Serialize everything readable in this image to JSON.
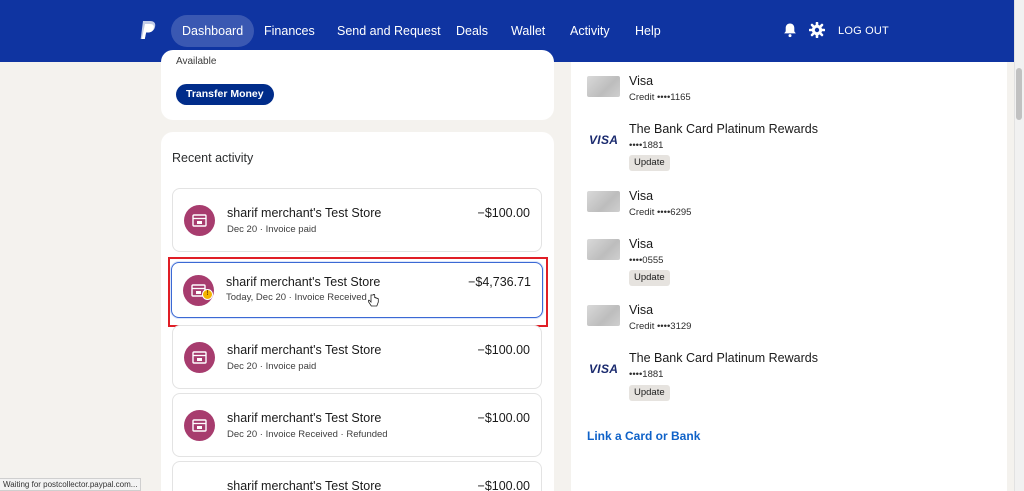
{
  "header": {
    "nav": [
      "Dashboard",
      "Finances",
      "Send and Request",
      "Deals",
      "Wallet",
      "Activity",
      "Help"
    ],
    "logout": "LOG OUT",
    "icons": [
      "paypal-logo",
      "bell-icon",
      "gear-icon"
    ],
    "colors": {
      "bar": "#0f34a1"
    }
  },
  "balance": {
    "available_label": "Available",
    "transfer_label": "Transfer Money"
  },
  "activity": {
    "title": "Recent activity",
    "rows": [
      {
        "merchant": "sharif merchant's Test Store",
        "date": "Dec 20",
        "status": "Invoice paid",
        "amount": "−$100.00"
      },
      {
        "merchant": "sharif merchant's Test Store",
        "date": "Today, Dec 20",
        "status": "Invoice Received",
        "amount": "−$4,736.71"
      },
      {
        "merchant": "sharif merchant's Test Store",
        "date": "Dec 20",
        "status": "Invoice paid",
        "amount": "−$100.00"
      },
      {
        "merchant": "sharif merchant's Test Store",
        "date": "Dec 20",
        "status": "Invoice Received",
        "status2": "Refunded",
        "amount": "−$100.00"
      },
      {
        "merchant": "sharif merchant's Test Store",
        "amount": "−$100.00"
      }
    ]
  },
  "wallet": {
    "cards": [
      {
        "name": "Visa",
        "detail": "Credit ••••1165"
      },
      {
        "name": "The Bank Card Platinum Rewards",
        "detail": "••••1881",
        "logo": "VISA",
        "update": "Update"
      },
      {
        "name": "Visa",
        "detail": "Credit ••••6295"
      },
      {
        "name": "Visa",
        "detail": "••••0555",
        "update": "Update"
      },
      {
        "name": "Visa",
        "detail": "Credit ••••3129"
      },
      {
        "name": "The Bank Card Platinum Rewards",
        "detail": "••••1881",
        "logo": "VISA",
        "update": "Update"
      }
    ],
    "link_label": "Link a Card or Bank"
  },
  "status_bar": "Waiting for postcollector.paypal.com..."
}
